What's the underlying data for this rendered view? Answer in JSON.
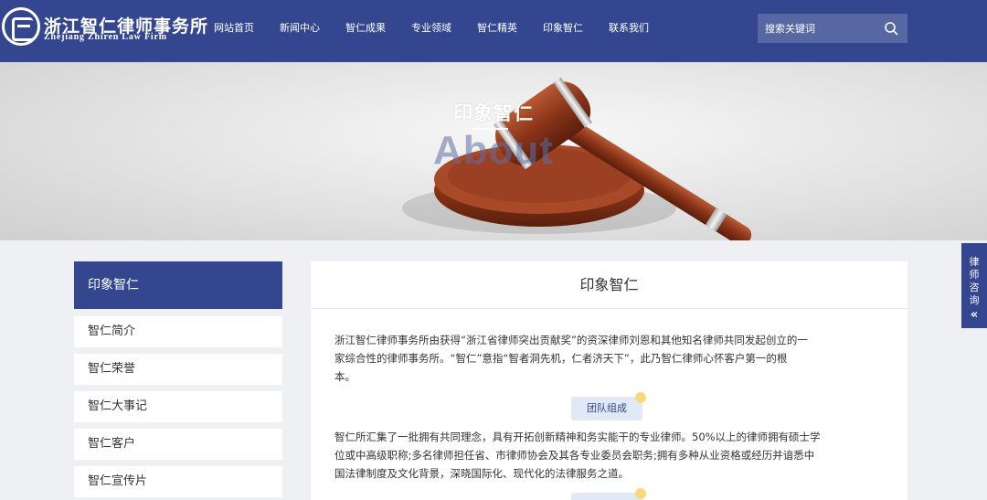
{
  "header": {
    "brand_cn": "浙江智仁律师事务所",
    "brand_en": "Zhejiang Zhiren Law Firm",
    "nav": [
      "网站首页",
      "新闻中心",
      "智仁成果",
      "专业领域",
      "智仁精英",
      "印象智仁",
      "联系我们"
    ],
    "search_placeholder": "搜索关键词"
  },
  "banner": {
    "title": "印象智仁",
    "subtitle": "About"
  },
  "sidebar": {
    "title": "印象智仁",
    "items": [
      "智仁简介",
      "智仁荣誉",
      "智仁大事记",
      "智仁客户",
      "智仁宣传片"
    ]
  },
  "main": {
    "title": "印象智仁",
    "intro_lines": [
      "浙江智仁律师事务所由获得“浙江省律师突出贡献奖”的资深律师刘恩和其他知名律师共同发起创立的一",
      "家综合性的律师事务所。“智仁”意指“智者洞先机，仁者济天下”，此乃智仁律师心怀客户第一的根",
      "本。"
    ],
    "section_label": "团队组成",
    "team_lines": [
      "智仁所汇集了一批拥有共同理念，具有开拓创新精神和务实能干的专业律师。50%以上的律师拥有硕士学",
      "位或中高级职称;多名律师担任省、市律师协会及其各专业委员会职务;拥有多种从业资格或经历并谙悉中",
      "国法律制度及文化背景，深晓国际化、现代化的法律服务之道。"
    ]
  },
  "consult": {
    "label": [
      "律",
      "师",
      "咨",
      "询"
    ],
    "chevron": "«"
  },
  "colors": {
    "primary": "#33468f",
    "page_bg": "#eef0f4",
    "pill_bg": "#e1e8f6",
    "pill_dot": "#f6d97a"
  }
}
